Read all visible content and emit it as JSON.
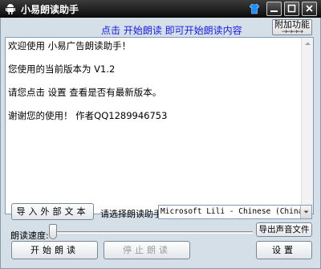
{
  "window": {
    "title": "小易朗读助手",
    "icons": {
      "app": "android-icon",
      "skin": "tshirt-icon",
      "minimize": "minimize-icon",
      "maximize": "maximize-icon",
      "close": "close-icon"
    }
  },
  "hint": "点击 开始朗读 即可开始朗读内容",
  "extra_button": {
    "label": "附加功能",
    "arrows": "→→→→"
  },
  "text_content": {
    "lines": [
      "欢迎使用 小易广告朗读助手！",
      "您使用的当前版本为 V1.2",
      "请您点击 设置 查看是否有最新版本。",
      "谢谢您的使用！    作者QQ1289946753"
    ]
  },
  "controls": {
    "import_button": "导入外部文本",
    "voice_label": "请选择朗读助手:",
    "voice_selected": "Microsoft Lili - Chinese (China)",
    "speed_label": "朗读速度:",
    "speed_value": 0,
    "export_button": "导出声音文件",
    "start_button": "开始朗读",
    "stop_button": "停止朗读",
    "settings_button": "设置"
  },
  "colors": {
    "titlebar": "#1a1a1a",
    "hint_text": "#1a1aee",
    "client_bg": "#d4dfe8"
  }
}
